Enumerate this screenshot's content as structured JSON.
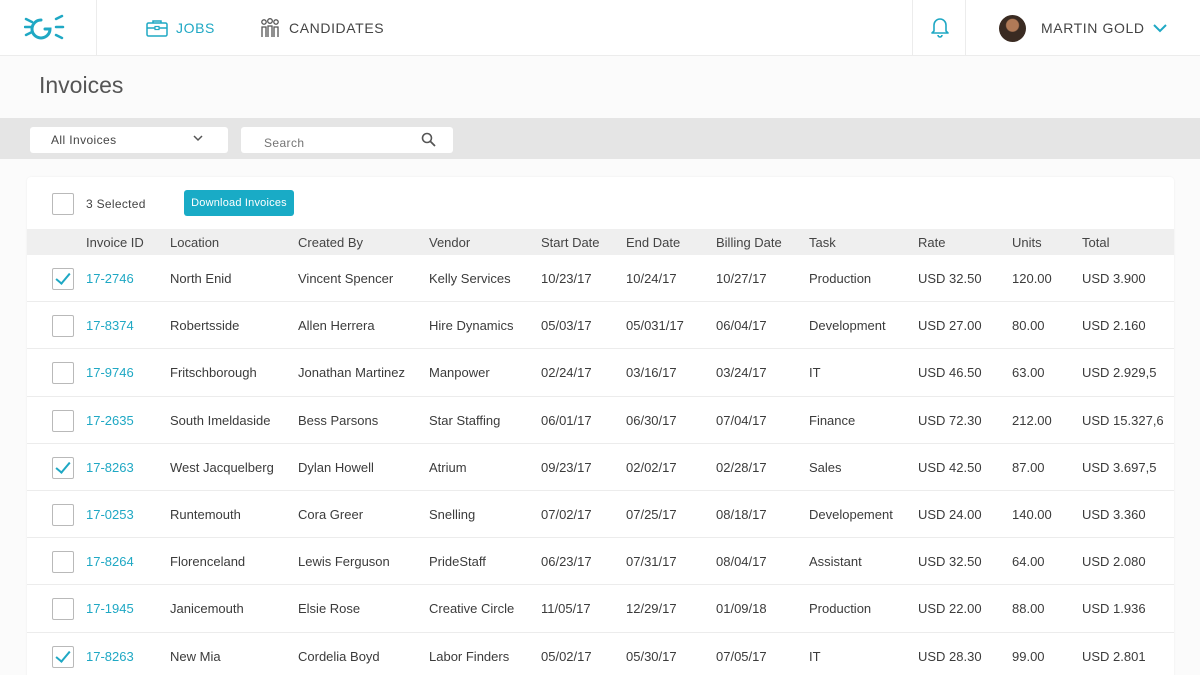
{
  "nav": {
    "jobs": "JOBS",
    "candidates": "CANDIDATES",
    "user_name": "MARTIN GOLD"
  },
  "page": {
    "title": "Invoices"
  },
  "filters": {
    "select_value": "All Invoices",
    "search_placeholder": "Search"
  },
  "selection": {
    "selected_text": "3 Selected",
    "download_label": "Download Invoices"
  },
  "table": {
    "columns": [
      "Invoice ID",
      "Location",
      "Created By",
      "Vendor",
      "Start Date",
      "End Date",
      "Billing Date",
      "Task",
      "Rate",
      "Units",
      "Total"
    ],
    "rows": [
      {
        "checked": true,
        "cells": [
          "17-2746",
          "North Enid",
          "Vincent Spencer",
          "Kelly Services",
          "10/23/17",
          "10/24/17",
          "10/27/17",
          "Production",
          "USD 32.50",
          "120.00",
          "USD 3.900"
        ]
      },
      {
        "checked": false,
        "cells": [
          "17-8374",
          "Robertsside",
          "Allen Herrera",
          "Hire Dynamics",
          "05/03/17",
          "05/031/17",
          "06/04/17",
          "Development",
          "USD 27.00",
          "80.00",
          "USD 2.160"
        ]
      },
      {
        "checked": false,
        "cells": [
          "17-9746",
          "Fritschborough",
          "Jonathan Martinez",
          "Manpower",
          "02/24/17",
          "03/16/17",
          "03/24/17",
          "IT",
          "USD 46.50",
          "63.00",
          "USD 2.929,5"
        ]
      },
      {
        "checked": false,
        "cells": [
          "17-2635",
          "South Imeldaside",
          "Bess Parsons",
          "Star Staffing",
          "06/01/17",
          "06/30/17",
          "07/04/17",
          "Finance",
          "USD 72.30",
          "212.00",
          "USD 15.327,6"
        ]
      },
      {
        "checked": true,
        "cells": [
          "17-8263",
          "West Jacquelberg",
          "Dylan Howell",
          "Atrium",
          "09/23/17",
          "02/02/17",
          "02/28/17",
          "Sales",
          "USD 42.50",
          "87.00",
          "USD 3.697,5"
        ]
      },
      {
        "checked": false,
        "cells": [
          "17-0253",
          "Runtemouth",
          "Cora Greer",
          "Snelling",
          "07/02/17",
          "07/25/17",
          "08/18/17",
          "Developement",
          "USD 24.00",
          "140.00",
          "USD 3.360"
        ]
      },
      {
        "checked": false,
        "cells": [
          "17-8264",
          "Florenceland",
          "Lewis Ferguson",
          "PrideStaff",
          "06/23/17",
          "07/31/17",
          "08/04/17",
          "Assistant",
          "USD 32.50",
          "64.00",
          "USD 2.080"
        ]
      },
      {
        "checked": false,
        "cells": [
          "17-1945",
          "Janicemouth",
          "Elsie Rose",
          "Creative Circle",
          "11/05/17",
          "12/29/17",
          "01/09/18",
          "Production",
          "USD 22.00",
          "88.00",
          "USD 1.936"
        ]
      },
      {
        "checked": true,
        "cells": [
          "17-8263",
          "New Mia",
          "Cordelia Boyd",
          "Labor Finders",
          "05/02/17",
          "05/30/17",
          "07/05/17",
          "IT",
          "USD 28.30",
          "99.00",
          "USD 2.801"
        ]
      }
    ]
  },
  "colors": {
    "accent": "#1fa8c4",
    "button": "#19abc6"
  }
}
